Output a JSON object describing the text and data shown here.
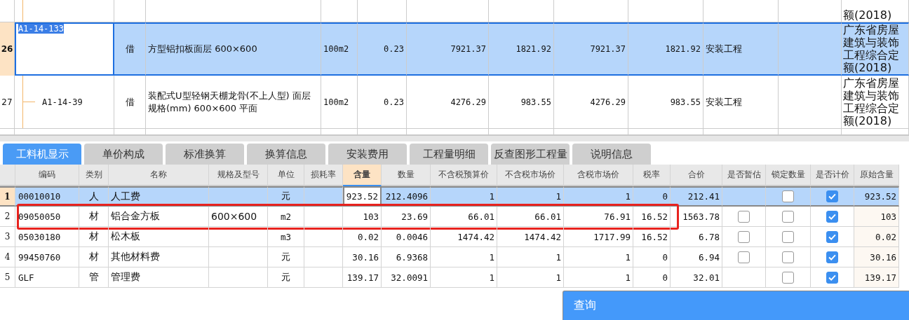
{
  "quota_table": {
    "rows": [
      {
        "kind": "partial",
        "selected": false,
        "column_12": "额(2018)"
      },
      {
        "kind": "full",
        "number": "26",
        "selected": true,
        "column_1": "A1-14-133",
        "column_2": "借",
        "column_3": "方型铝扣板面层 600×600",
        "column_4": "100m2",
        "column_5": "0.23",
        "column_6": "7921.37",
        "column_7": "1821.92",
        "column_8": "7921.37",
        "column_9": "1821.92",
        "column_10": "安装工程",
        "column_12": "广东省房屋建筑与装饰工程综合定额(2018)"
      },
      {
        "kind": "full",
        "number": "27",
        "selected": false,
        "column_1": "A1-14-39",
        "column_2": "借",
        "column_3": "装配式U型轻钢天棚龙骨(不上人型) 面层规格(mm) 600×600 平面",
        "column_4": "100m2",
        "column_5": "0.23",
        "column_6": "4276.29",
        "column_7": "983.55",
        "column_8": "4276.29",
        "column_9": "983.55",
        "column_10": "安装工程",
        "column_12": "广东省房屋建筑与装饰工程综合定额(2018)"
      }
    ]
  },
  "tabs": [
    {
      "label": "工料机显示",
      "selected": true
    },
    {
      "label": "单价构成",
      "selected": false
    },
    {
      "label": "标准换算",
      "selected": false
    },
    {
      "label": "换算信息",
      "selected": false
    },
    {
      "label": "安装费用",
      "selected": false
    },
    {
      "label": "工程量明细",
      "selected": false
    },
    {
      "label": "反查图形工程量",
      "selected": false
    },
    {
      "label": "说明信息",
      "selected": false
    }
  ],
  "resource_table": {
    "columns": [
      {
        "label": "编码",
        "selected": false
      },
      {
        "label": "类别",
        "selected": false
      },
      {
        "label": "名称",
        "selected": false
      },
      {
        "label": "规格及型号",
        "selected": false
      },
      {
        "label": "单位",
        "selected": false
      },
      {
        "label": "损耗率",
        "selected": false
      },
      {
        "label": "含量",
        "selected": true
      },
      {
        "label": "数量",
        "selected": false
      },
      {
        "label": "不含税预算价",
        "selected": false
      },
      {
        "label": "不含税市场价",
        "selected": false
      },
      {
        "label": "含税市场价",
        "selected": false
      },
      {
        "label": "税率",
        "selected": false
      },
      {
        "label": "合价",
        "selected": false
      },
      {
        "label": "是否暂估",
        "selected": false
      },
      {
        "label": "锁定数量",
        "selected": false
      },
      {
        "label": "是否计价",
        "selected": false
      },
      {
        "label": "原始含量",
        "selected": false
      }
    ],
    "rows": [
      {
        "number": "1",
        "selected": true,
        "annotated": false,
        "code": "00010010",
        "type": "人",
        "name": "人工费",
        "unit": "元",
        "content": "923.52",
        "quantity": "212.4096",
        "budget_price": "1",
        "market_price": "1",
        "market_price_tax": "1",
        "tax_rate": "0",
        "total": "212.41",
        "locked": false,
        "priced": true,
        "original": "923.52"
      },
      {
        "number": "2",
        "selected": false,
        "annotated": true,
        "code": "09050050",
        "type": "材",
        "name": "铝合金方板",
        "spec": "600×600",
        "unit": "m2",
        "content": "103",
        "quantity": "23.69",
        "budget_price": "66.01",
        "market_price": "66.01",
        "market_price_tax": "76.91",
        "tax_rate": "16.52",
        "total": "1563.78",
        "provisional": false,
        "locked": false,
        "priced": true,
        "original": "103"
      },
      {
        "number": "3",
        "selected": false,
        "annotated": false,
        "code": "05030180",
        "type": "材",
        "name": "松木板",
        "unit": "m3",
        "content": "0.02",
        "quantity": "0.0046",
        "budget_price": "1474.42",
        "market_price": "1474.42",
        "market_price_tax": "1717.99",
        "tax_rate": "16.52",
        "total": "6.78",
        "provisional": false,
        "locked": false,
        "priced": true,
        "original": "0.02"
      },
      {
        "number": "4",
        "selected": false,
        "annotated": false,
        "code": "99450760",
        "type": "材",
        "name": "其他材料费",
        "unit": "元",
        "content": "30.16",
        "quantity": "6.9368",
        "budget_price": "1",
        "market_price": "1",
        "market_price_tax": "1",
        "tax_rate": "0",
        "total": "6.94",
        "provisional": false,
        "locked": false,
        "priced": true,
        "original": "30.16"
      },
      {
        "number": "5",
        "selected": false,
        "annotated": false,
        "code": "GLF",
        "type": "管",
        "name": "管理费",
        "unit": "元",
        "content": "139.17",
        "quantity": "32.0091",
        "budget_price": "1",
        "market_price": "1",
        "market_price_tax": "1",
        "tax_rate": "0",
        "total": "32.01",
        "locked": false,
        "priced": true,
        "original": "139.17"
      }
    ]
  },
  "query_panel": {
    "title": "查询"
  }
}
